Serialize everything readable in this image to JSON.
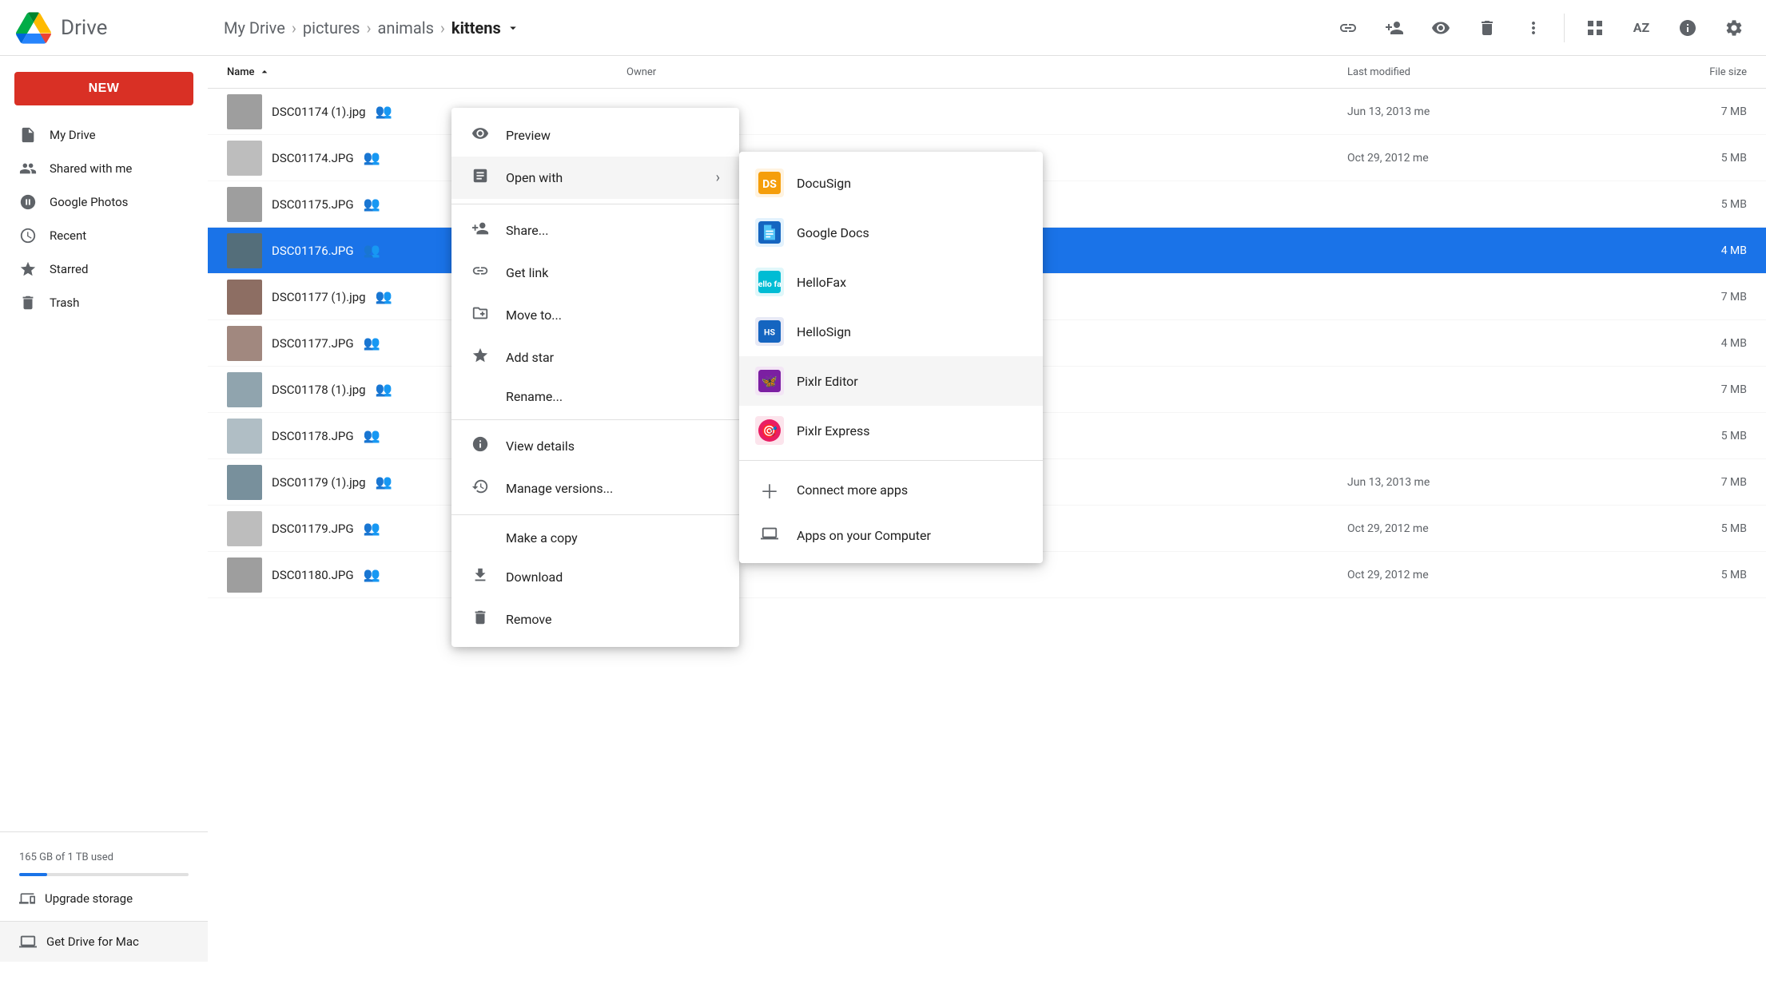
{
  "header": {
    "logo_text": "Drive",
    "breadcrumb": [
      {
        "label": "My Drive",
        "id": "my-drive"
      },
      {
        "label": "pictures",
        "id": "pictures"
      },
      {
        "label": "animals",
        "id": "animals"
      },
      {
        "label": "kittens",
        "id": "kittens",
        "current": true
      }
    ],
    "actions": [
      {
        "id": "link",
        "icon": "🔗",
        "label": "Get link"
      },
      {
        "id": "add-person",
        "icon": "👤+",
        "label": "Share"
      },
      {
        "id": "preview",
        "icon": "👁",
        "label": "Preview"
      },
      {
        "id": "delete",
        "icon": "🗑",
        "label": "Delete"
      },
      {
        "id": "more",
        "icon": "⋮",
        "label": "More"
      },
      {
        "id": "grid",
        "icon": "⊞",
        "label": "Grid view"
      },
      {
        "id": "sort",
        "icon": "AZ",
        "label": "Sort"
      },
      {
        "id": "info",
        "icon": "ℹ",
        "label": "Details"
      },
      {
        "id": "settings",
        "icon": "⚙",
        "label": "Settings"
      }
    ]
  },
  "sidebar": {
    "new_button_label": "NEW",
    "items": [
      {
        "id": "my-drive",
        "icon": "📁",
        "label": "My Drive"
      },
      {
        "id": "shared",
        "icon": "👥",
        "label": "Shared with me"
      },
      {
        "id": "photos",
        "icon": "📷",
        "label": "Google Photos"
      },
      {
        "id": "recent",
        "icon": "🕐",
        "label": "Recent"
      },
      {
        "id": "starred",
        "icon": "⭐",
        "label": "Starred"
      },
      {
        "id": "trash",
        "icon": "🗑",
        "label": "Trash"
      }
    ],
    "storage_text": "165 GB of 1 TB used",
    "upgrade_label": "Upgrade storage",
    "get_drive_label": "Get Drive for Mac"
  },
  "table": {
    "headers": {
      "name": "Name",
      "owner": "Owner",
      "modified": "Last modified",
      "size": "File size"
    },
    "rows": [
      {
        "id": "row1",
        "name": "DSC01174 (1).jpg",
        "owner": "me",
        "modified": "Jun 13, 2013 me",
        "size": "7 MB",
        "selected": false
      },
      {
        "id": "row2",
        "name": "DSC01174.JPG",
        "owner": "",
        "modified": "Oct 29, 2012 me",
        "size": "5 MB",
        "selected": false
      },
      {
        "id": "row3",
        "name": "DSC01175.JPG",
        "owner": "",
        "modified": "",
        "size": "5 MB",
        "selected": false
      },
      {
        "id": "row4",
        "name": "DSC01176.JPG",
        "owner": "",
        "modified": "",
        "size": "4 MB",
        "selected": true
      },
      {
        "id": "row5",
        "name": "DSC01177 (1).jpg",
        "owner": "",
        "modified": "",
        "size": "7 MB",
        "selected": false
      },
      {
        "id": "row6",
        "name": "DSC01177.JPG",
        "owner": "",
        "modified": "",
        "size": "4 MB",
        "selected": false
      },
      {
        "id": "row7",
        "name": "DSC01178 (1).jpg",
        "owner": "",
        "modified": "",
        "size": "7 MB",
        "selected": false
      },
      {
        "id": "row8",
        "name": "DSC01178.JPG",
        "owner": "",
        "modified": "",
        "size": "5 MB",
        "selected": false
      },
      {
        "id": "row9",
        "name": "DSC01179 (1).jpg",
        "owner": "",
        "modified": "Jun 13, 2013 me",
        "size": "7 MB",
        "selected": false
      },
      {
        "id": "row10",
        "name": "DSC01179.JPG",
        "owner": "",
        "modified": "Oct 29, 2012 me",
        "size": "5 MB",
        "selected": false
      },
      {
        "id": "row11",
        "name": "DSC01180.JPG",
        "owner": "",
        "modified": "Oct 29, 2012 me",
        "size": "5 MB",
        "selected": false
      }
    ]
  },
  "context_menu": {
    "items": [
      {
        "id": "preview",
        "icon": "eye",
        "label": "Preview"
      },
      {
        "id": "open-with",
        "icon": "open",
        "label": "Open with",
        "has_submenu": true
      },
      {
        "id": "share",
        "icon": "share",
        "label": "Share..."
      },
      {
        "id": "get-link",
        "icon": "link",
        "label": "Get link"
      },
      {
        "id": "move-to",
        "icon": "move",
        "label": "Move to..."
      },
      {
        "id": "add-star",
        "icon": "star",
        "label": "Add star"
      },
      {
        "id": "rename",
        "icon": "rename",
        "label": "Rename..."
      },
      {
        "id": "view-details",
        "icon": "info",
        "label": "View details"
      },
      {
        "id": "manage-versions",
        "icon": "history",
        "label": "Manage versions..."
      },
      {
        "id": "make-copy",
        "icon": "copy",
        "label": "Make a copy"
      },
      {
        "id": "download",
        "icon": "download",
        "label": "Download"
      },
      {
        "id": "remove",
        "icon": "trash",
        "label": "Remove"
      }
    ]
  },
  "submenu": {
    "items": [
      {
        "id": "docusign",
        "label": "DocuSign",
        "color": "#f5a623"
      },
      {
        "id": "google-docs",
        "label": "Google Docs",
        "color": "#1a73e8"
      },
      {
        "id": "hellofax",
        "label": "HelloFax",
        "color": "#00bcd4"
      },
      {
        "id": "hellosign",
        "label": "HelloSign",
        "color": "#1565c0"
      },
      {
        "id": "pixlr-editor",
        "label": "Pixlr Editor",
        "color": "#7b1fa2",
        "highlighted": true
      },
      {
        "id": "pixlr-express",
        "label": "Pixlr Express",
        "color": "#e91e63"
      }
    ],
    "extras": [
      {
        "id": "connect-more",
        "label": "Connect more apps"
      },
      {
        "id": "apps-computer",
        "label": "Apps on your Computer"
      }
    ]
  }
}
